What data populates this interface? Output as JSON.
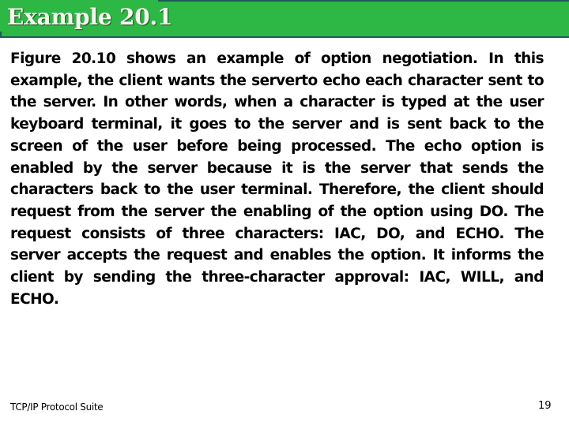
{
  "slide": {
    "title": "Example 20.1",
    "body": "Figure 20.10 shows an example of option negotiation. In this example, the client wants the serverto echo each character sent to the server. In other words, when a character is typed at the user keyboard terminal, it goes to the server and is sent back to the screen of the user before being processed. The echo option is enabled by the server because it is the server that sends the characters back to the user terminal. Therefore, the client should request from the server the enabling of the option using DO. The request consists of three characters: IAC, DO, and ECHO. The server accepts the request and enables the option. It informs the client by sending the three-character approval: IAC, WILL, and ECHO.",
    "footer": {
      "course": "TCP/IP Protocol Suite",
      "page_number": "19"
    }
  },
  "colors": {
    "banner_green": "#2db845",
    "banner_border": "#1f5a5a",
    "title_text": "#f4f8ec",
    "body_text": "#000000"
  }
}
